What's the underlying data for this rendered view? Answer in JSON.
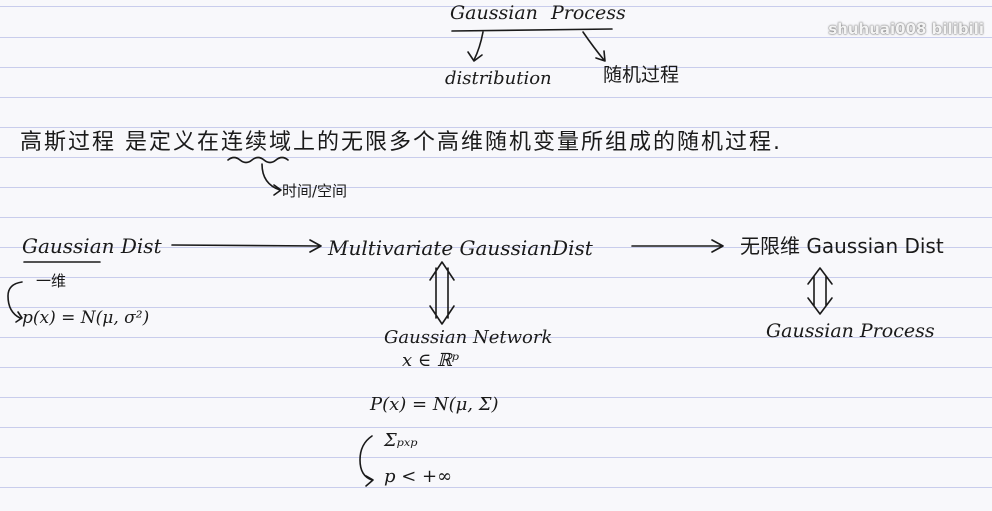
{
  "watermark": "shuhuai008 bilibili",
  "top": {
    "title_left": "Gaussian",
    "title_right": "Process",
    "branch_left": "distribution",
    "branch_right": "随机过程"
  },
  "definition": {
    "text": "高斯过程 是定义在连续域上的无限多个高维随机变量所组成的随机过程.",
    "note": "时间/空间"
  },
  "chain": {
    "dist": "Gaussian Dist",
    "multivariate": "Multivariate GaussianDist",
    "infinite": "无限维 Gaussian Dist"
  },
  "one_dim": {
    "label": "一维",
    "formula": "p(x) = N(μ, σ²)"
  },
  "network": {
    "title": "Gaussian Network",
    "domain": "x ∈ ℝᵖ",
    "formula": "P(x) = N(μ, Σ)",
    "cov": "Σₚₓₚ",
    "dim": "p < +∞"
  },
  "process": {
    "label": "Gaussian Process"
  }
}
